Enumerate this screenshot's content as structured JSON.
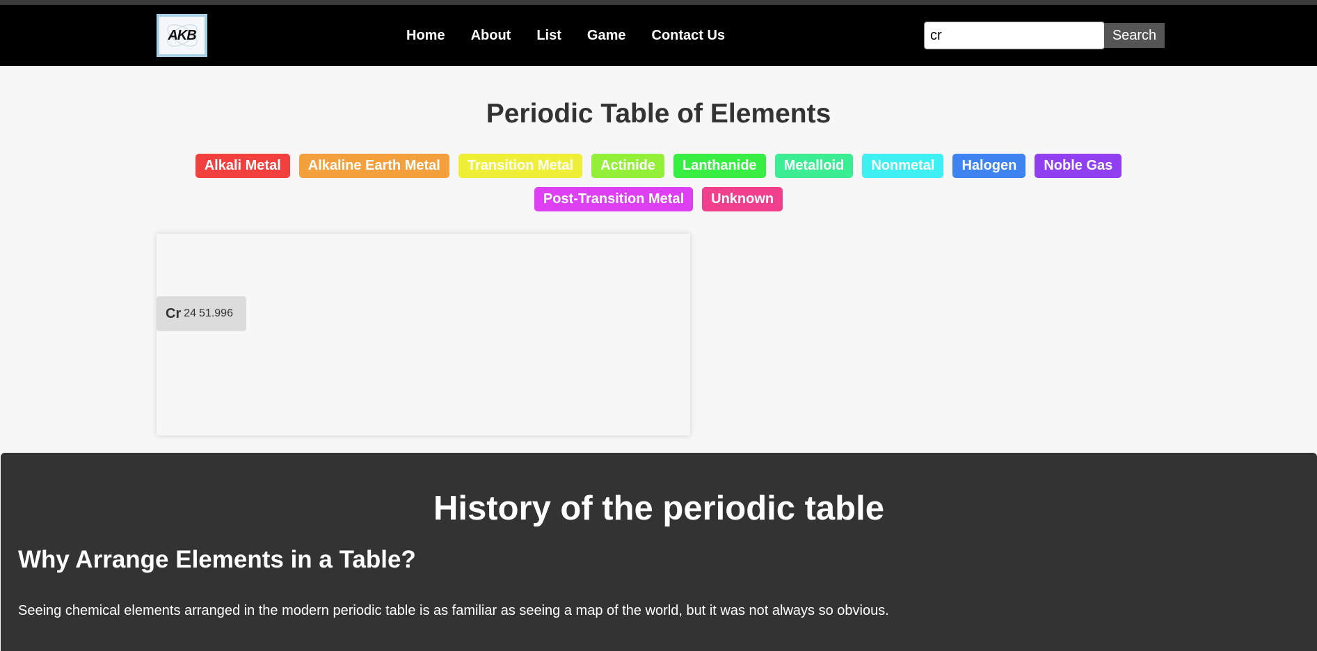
{
  "navbar": {
    "logo_text": "AKB",
    "links": [
      "Home",
      "About",
      "List",
      "Game",
      "Contact Us"
    ],
    "search_value": "cr",
    "search_button": "Search"
  },
  "main": {
    "title": "Periodic Table of Elements",
    "categories": [
      {
        "label": "Alkali Metal",
        "color": "#f2403f"
      },
      {
        "label": "Alkaline Earth Metal",
        "color": "#f4a03c"
      },
      {
        "label": "Transition Metal",
        "color": "#f0ef38"
      },
      {
        "label": "Actinide",
        "color": "#94ef38"
      },
      {
        "label": "Lanthanide",
        "color": "#38ee43"
      },
      {
        "label": "Metalloid",
        "color": "#3ced93"
      },
      {
        "label": "Nonmetal",
        "color": "#3ef0f2"
      },
      {
        "label": "Halogen",
        "color": "#3f83f0"
      },
      {
        "label": "Noble Gas",
        "color": "#9040f0"
      },
      {
        "label": "Post-Transition Metal",
        "color": "#dc40f2"
      },
      {
        "label": "Unknown",
        "color": "#f03f8c"
      }
    ],
    "search_result": {
      "symbol": "Cr",
      "number": "24",
      "mass": "51.996"
    }
  },
  "history": {
    "title": "History of the periodic table",
    "subtitle": "Why Arrange Elements in a Table?",
    "paragraph": "Seeing chemical elements arranged in the modern periodic table is as familiar as seeing a map of the world, but it was not always so obvious."
  }
}
